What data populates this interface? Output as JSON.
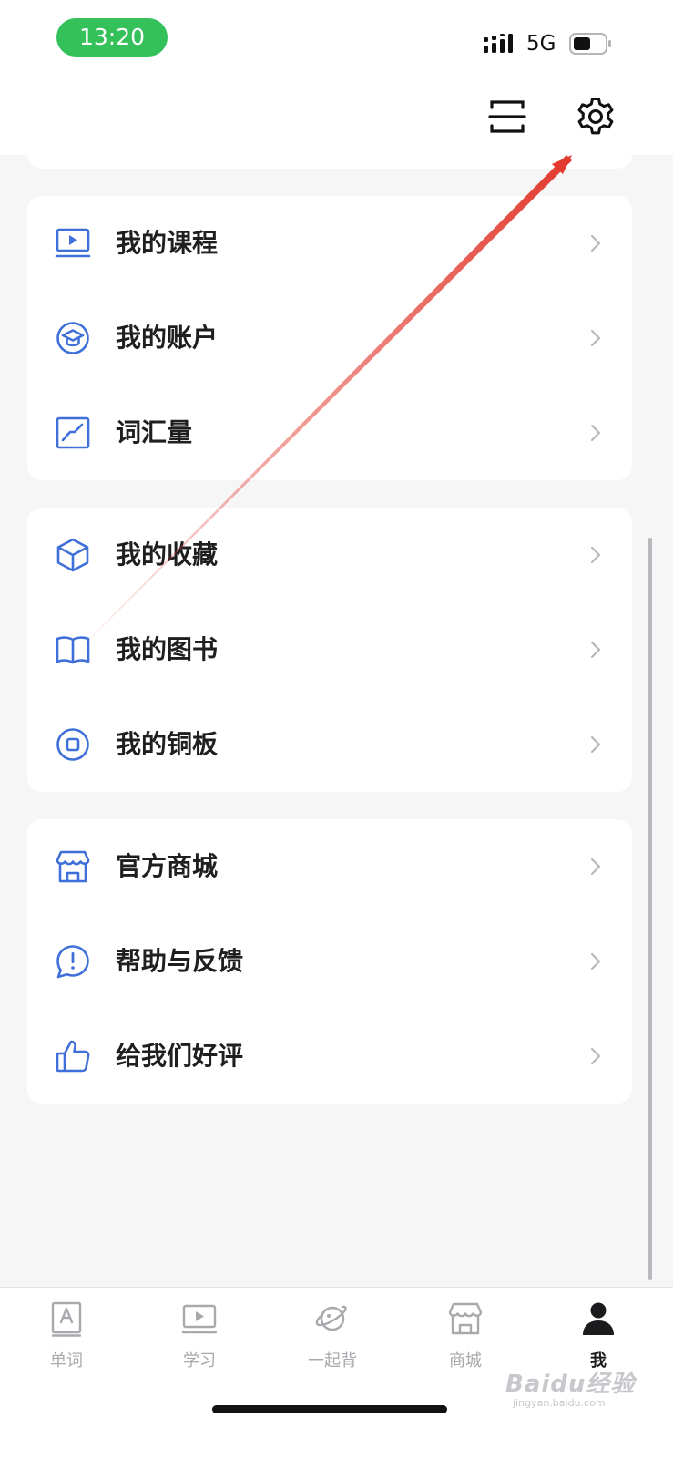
{
  "status_bar": {
    "time": "13:20",
    "network": "5G"
  },
  "header": {
    "scan_icon": "scan-icon",
    "settings_icon": "gear-icon"
  },
  "colors": {
    "accent": "#3f6fd8",
    "time_pill": "#34c159",
    "annotation_arrow": "#e23a2e"
  },
  "menu_groups": [
    {
      "items": [
        {
          "label": "我的课程",
          "icon": "course-video-icon"
        },
        {
          "label": "我的账户",
          "icon": "account-badge-icon"
        },
        {
          "label": "词汇量",
          "icon": "vocabulary-chart-icon"
        }
      ]
    },
    {
      "items": [
        {
          "label": "我的收藏",
          "icon": "favorites-box-icon"
        },
        {
          "label": "我的图书",
          "icon": "book-icon"
        },
        {
          "label": "我的铜板",
          "icon": "coin-icon"
        }
      ]
    },
    {
      "items": [
        {
          "label": "官方商城",
          "icon": "store-icon"
        },
        {
          "label": "帮助与反馈",
          "icon": "feedback-icon"
        },
        {
          "label": "给我们好评",
          "icon": "thumbs-up-icon"
        }
      ]
    }
  ],
  "tabbar": {
    "tabs": [
      {
        "label": "单词",
        "icon": "word-card-icon",
        "active": false
      },
      {
        "label": "学习",
        "icon": "study-video-icon",
        "active": false
      },
      {
        "label": "一起背",
        "icon": "planet-icon",
        "active": false
      },
      {
        "label": "商城",
        "icon": "store-icon",
        "active": false
      },
      {
        "label": "我",
        "icon": "person-icon",
        "active": true
      }
    ]
  },
  "watermark": {
    "brand": "Baidu经验",
    "url": "jingyan.baidu.com"
  }
}
